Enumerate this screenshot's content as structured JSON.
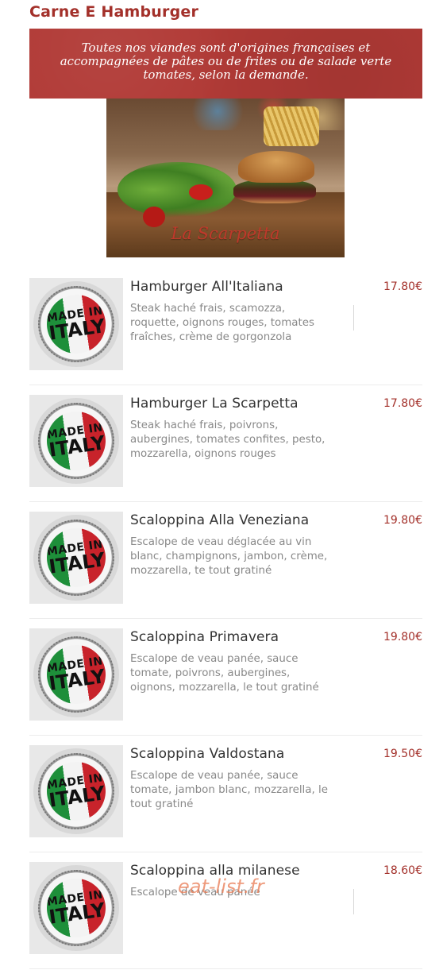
{
  "section": {
    "title": "Carne E Hamburger"
  },
  "banner": {
    "text": "Toutes nos viandes sont d'origines françaises et accompagnées de pâtes ou de frites ou de salade verte tomates, selon la demande."
  },
  "hero": {
    "caption": "La Scarpetta"
  },
  "badge": {
    "line1": "MADE IN",
    "line2": "ITALY"
  },
  "items": [
    {
      "name": "Hamburger All'Italiana",
      "desc": "Steak haché frais, scamozza, roquette, oignons rouges, tomates fraîches, crème de gorgonzola",
      "price": "17.80€"
    },
    {
      "name": "Hamburger La Scarpetta",
      "desc": "Steak haché frais, poivrons, aubergines, tomates confites, pesto, mozzarella, oignons rouges",
      "price": "17.80€"
    },
    {
      "name": "Scaloppina Alla Veneziana",
      "desc": "Escalope de veau déglacée au vin blanc, champignons, jambon, crème, mozzarella, te tout gratiné",
      "price": "19.80€"
    },
    {
      "name": "Scaloppina Primavera",
      "desc": "Escalope de veau panée, sauce tomate, poivrons, aubergines, oignons, mozzarella, le tout gratiné",
      "price": "19.80€"
    },
    {
      "name": "Scaloppina Valdostana",
      "desc": "Escalope de veau panée, sauce tomate, jambon blanc, mozzarella, le tout gratiné",
      "price": "19.50€"
    },
    {
      "name": "Scaloppina alla milanese",
      "desc": "Escalope de veau panée",
      "price": "18.60€"
    }
  ],
  "watermark": "eat-list.fr",
  "colors": {
    "accent": "#a3302a",
    "banner": "#b13a36",
    "text": "#333333",
    "muted": "#888888"
  }
}
